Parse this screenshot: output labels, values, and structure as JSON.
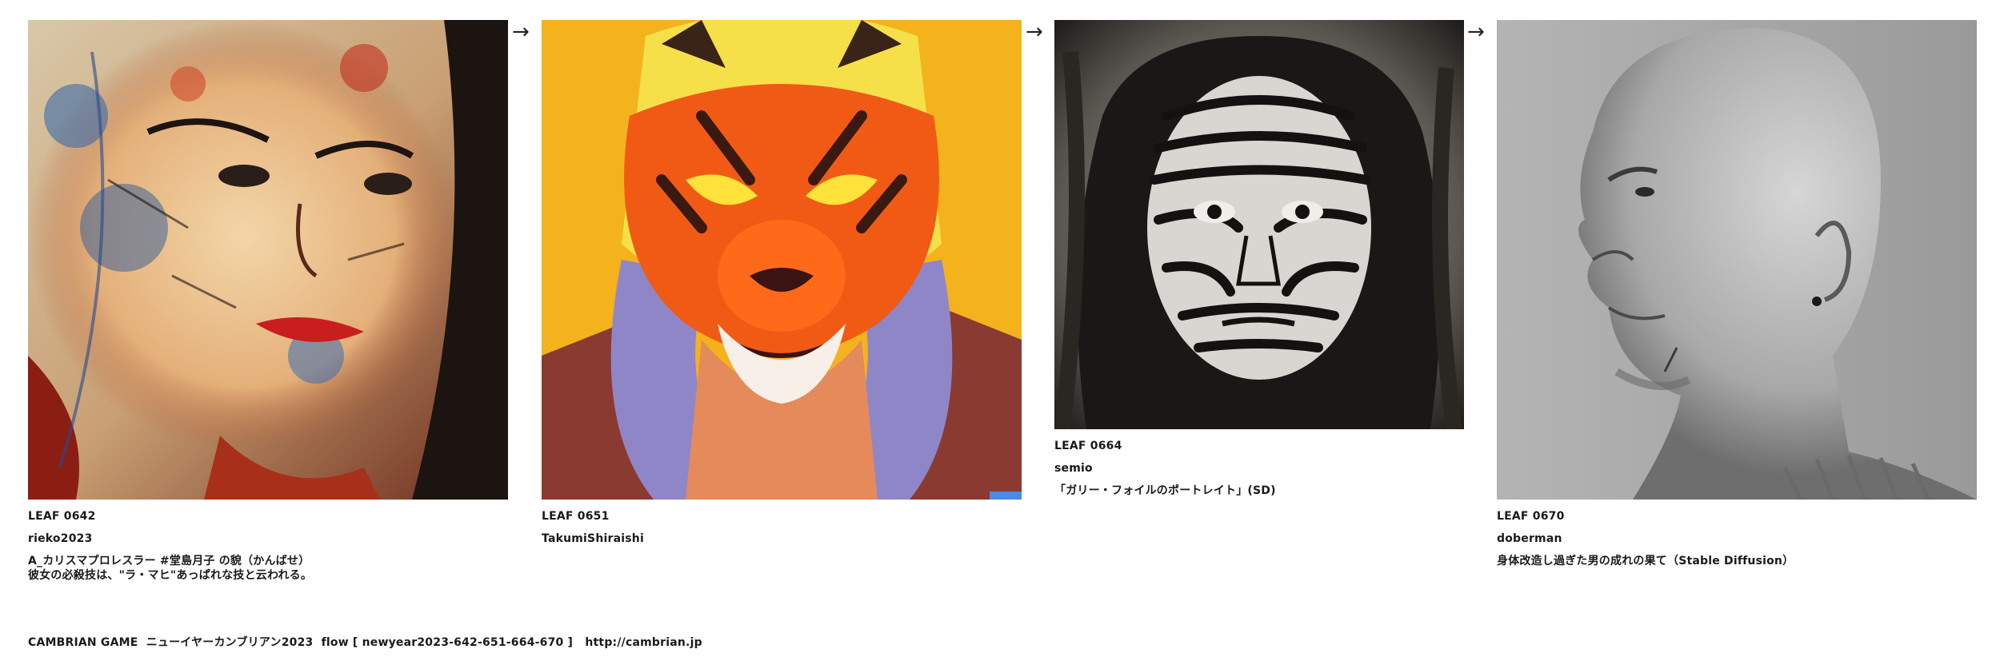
{
  "cards": [
    {
      "id": "LEAF 0642",
      "author": "rieko2023",
      "title": "A_カリスマプロレスラー #堂島月子 の貌（かんばせ）\n彼女の必殺技は、\"ラ・マヒ\"あっぱれな技と云われる。"
    },
    {
      "id": "LEAF 0651",
      "author": "TakumiShiraishi",
      "title": ""
    },
    {
      "id": "LEAF 0664",
      "author": "semio",
      "title": "「ガリー・フォイルのポートレイト」(SD)"
    },
    {
      "id": "LEAF 0670",
      "author": "doberman",
      "title": "身体改造し過ぎた男の成れの果て（Stable Diffusion）"
    }
  ],
  "arrow_glyph": "→",
  "footer": {
    "text": "CAMBRIAN GAME  ニューイヤーカンブリアン2023  flow [ newyear2023-642-651-664-670 ]   ",
    "link": "http://cambrian.jp"
  }
}
